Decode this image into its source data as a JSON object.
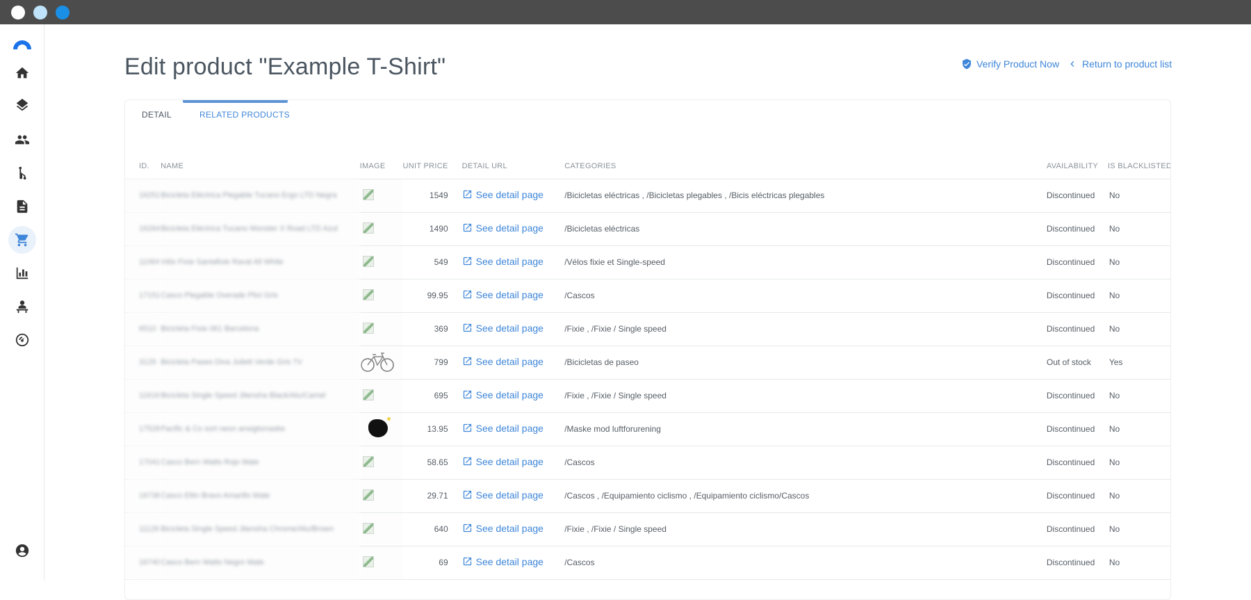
{
  "page": {
    "title": "Edit product \"Example T-Shirt\"",
    "verify_label": "Verify Product Now",
    "back_label": "Return to product list"
  },
  "tabs": [
    "DETAIL",
    "RELATED PRODUCTS"
  ],
  "table": {
    "headers": [
      "ID.",
      "NAME",
      "IMAGE",
      "UNIT PRICE",
      "DETAIL URL",
      "CATEGORIES",
      "AVAILABILITY",
      "IS BLACKLISTED"
    ],
    "rows": [
      {
        "id": "16251",
        "name": "Bicicleta Eléctrica Plegable Tucano Ergo LTD Negra",
        "image": "placeholder",
        "price": "1549",
        "url": "See detail page",
        "categories": "/Bicicletas eléctricas , /Bicicletas plegables , /Bicis eléctricas plegables",
        "availability": "Discontinued",
        "blacklisted": "No"
      },
      {
        "id": "16264",
        "name": "Bicicleta Eléctrica Tucano Monster X Road LTD Azul",
        "image": "placeholder",
        "price": "1490",
        "url": "See detail page",
        "categories": "/Bicicletas eléctricas",
        "availability": "Discontinued",
        "blacklisted": "No"
      },
      {
        "id": "11064",
        "name": "Vélo Fixie Santafixie Raval All White",
        "image": "placeholder",
        "price": "549",
        "url": "See detail page",
        "categories": "/Vélos fixie et Single-speed",
        "availability": "Discontinued",
        "blacklisted": "No"
      },
      {
        "id": "17151",
        "name": "Casco Plegable Overade Plixi Gris",
        "image": "placeholder",
        "price": "99.95",
        "url": "See detail page",
        "categories": "/Cascos",
        "availability": "Discontinued",
        "blacklisted": "No"
      },
      {
        "id": "6510",
        "name": "Bicicleta Fixie 061 Barcelona",
        "image": "placeholder",
        "price": "369",
        "url": "See detail page",
        "categories": "/Fixie , /Fixie / Single speed",
        "availability": "Discontinued",
        "blacklisted": "No"
      },
      {
        "id": "3129",
        "name": "Bicicleta Paseo Diva Juliett Verde Gris 7V",
        "image": "bicycle",
        "price": "799",
        "url": "See detail page",
        "categories": "/Bicicletas de paseo",
        "availability": "Out of stock",
        "blacklisted": "Yes"
      },
      {
        "id": "11616",
        "name": "Bicicleta Single Speed Jitensha Black/Alu/Camel",
        "image": "placeholder",
        "price": "695",
        "url": "See detail page",
        "categories": "/Fixie , /Fixie / Single speed",
        "availability": "Discontinued",
        "blacklisted": "No"
      },
      {
        "id": "17528",
        "name": "Pacific & Co sort neon ansigtsmaske",
        "image": "mask",
        "price": "13.95",
        "url": "See detail page",
        "categories": "/Maske mod luftforurening",
        "availability": "Discontinued",
        "blacklisted": "No"
      },
      {
        "id": "17041",
        "name": "Casco Bern Watts Rojo Mate",
        "image": "placeholder",
        "price": "58.65",
        "url": "See detail page",
        "categories": "/Cascos",
        "availability": "Discontinued",
        "blacklisted": "No"
      },
      {
        "id": "16736",
        "name": "Casco Eltin Bravo Amarillo Mate",
        "image": "placeholder",
        "price": "29.71",
        "url": "See detail page",
        "categories": "/Cascos , /Equipamiento ciclismo , /Equipamiento ciclismo/Cascos",
        "availability": "Discontinued",
        "blacklisted": "No"
      },
      {
        "id": "11126",
        "name": "Bicicleta Single Speed Jitensha Chrome/Alu/Brown",
        "image": "placeholder",
        "price": "640",
        "url": "See detail page",
        "categories": "/Fixie , /Fixie / Single speed",
        "availability": "Discontinued",
        "blacklisted": "No"
      },
      {
        "id": "16740",
        "name": "Casco Bern Watts Negro Mate",
        "image": "placeholder",
        "price": "69",
        "url": "See detail page",
        "categories": "/Cascos",
        "availability": "Discontinued",
        "blacklisted": "No"
      }
    ]
  },
  "sidebar": {
    "items": [
      "home-icon",
      "layers-icon",
      "people-icon",
      "merge-icon",
      "document-icon",
      "cart-icon",
      "bar-chart-icon",
      "person-desk-icon",
      "speedometer-icon"
    ],
    "active": "cart-icon",
    "footer": "account-icon"
  },
  "colors": {
    "accent": "#3e86d9",
    "titlebar": "#4c4c4c",
    "sidebar_active_bg": "#e9f1fb"
  }
}
